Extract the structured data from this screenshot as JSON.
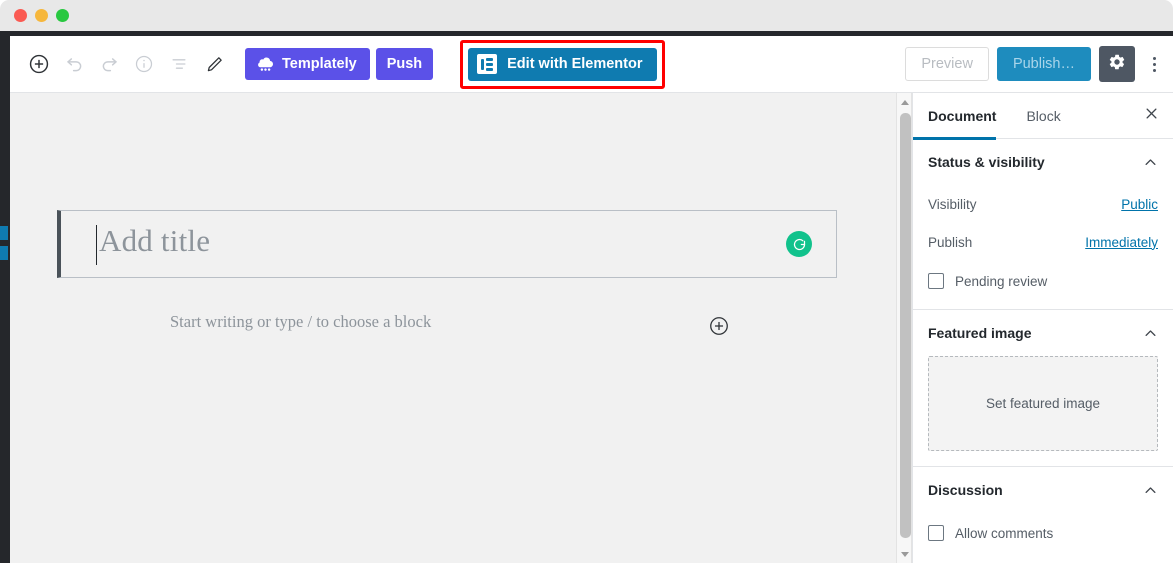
{
  "window": {
    "traffic_lights": [
      "close",
      "minimize",
      "maximize"
    ]
  },
  "toolbar": {
    "icons": [
      {
        "name": "add-block-icon",
        "label": "Add block"
      },
      {
        "name": "undo-icon",
        "label": "Undo"
      },
      {
        "name": "redo-icon",
        "label": "Redo"
      },
      {
        "name": "info-icon",
        "label": "Content structure"
      },
      {
        "name": "block-navigation-icon",
        "label": "Block navigation"
      },
      {
        "name": "edit-pencil-icon",
        "label": "Edit"
      }
    ],
    "templately_label": "Templately",
    "push_label": "Push",
    "elementor_label": "Edit with Elementor",
    "preview_label": "Preview",
    "publish_label": "Publish…",
    "settings_label": "Settings",
    "more_label": "More tools & options",
    "highlight_color": "#ff0000",
    "elementor_color": "#0f7bb0",
    "templately_color": "#5b51e8",
    "publish_color": "#1e8cbe",
    "gear_color": "#4e5763"
  },
  "editor": {
    "title_placeholder": "Add title",
    "body_placeholder": "Start writing or type / to choose a block",
    "add_block_label": "Add block",
    "grammarly_label": "G",
    "grammarly_color": "#11c28c",
    "canvas_color": "#f1f1f1"
  },
  "sidebar": {
    "tabs": [
      {
        "label": "Document",
        "active": true
      },
      {
        "label": "Block",
        "active": false
      }
    ],
    "close_label": "Close settings",
    "panels": [
      {
        "title": "Status & visibility",
        "rows": [
          {
            "label": "Visibility",
            "value": "Public"
          },
          {
            "label": "Publish",
            "value": "Immediately"
          }
        ],
        "checkbox": "Pending review"
      },
      {
        "title": "Featured image",
        "drop_label": "Set featured image"
      },
      {
        "title": "Discussion",
        "checkbox": "Allow comments"
      }
    ],
    "link_color": "#0073aa",
    "active_tab_color": "#0073aa"
  }
}
